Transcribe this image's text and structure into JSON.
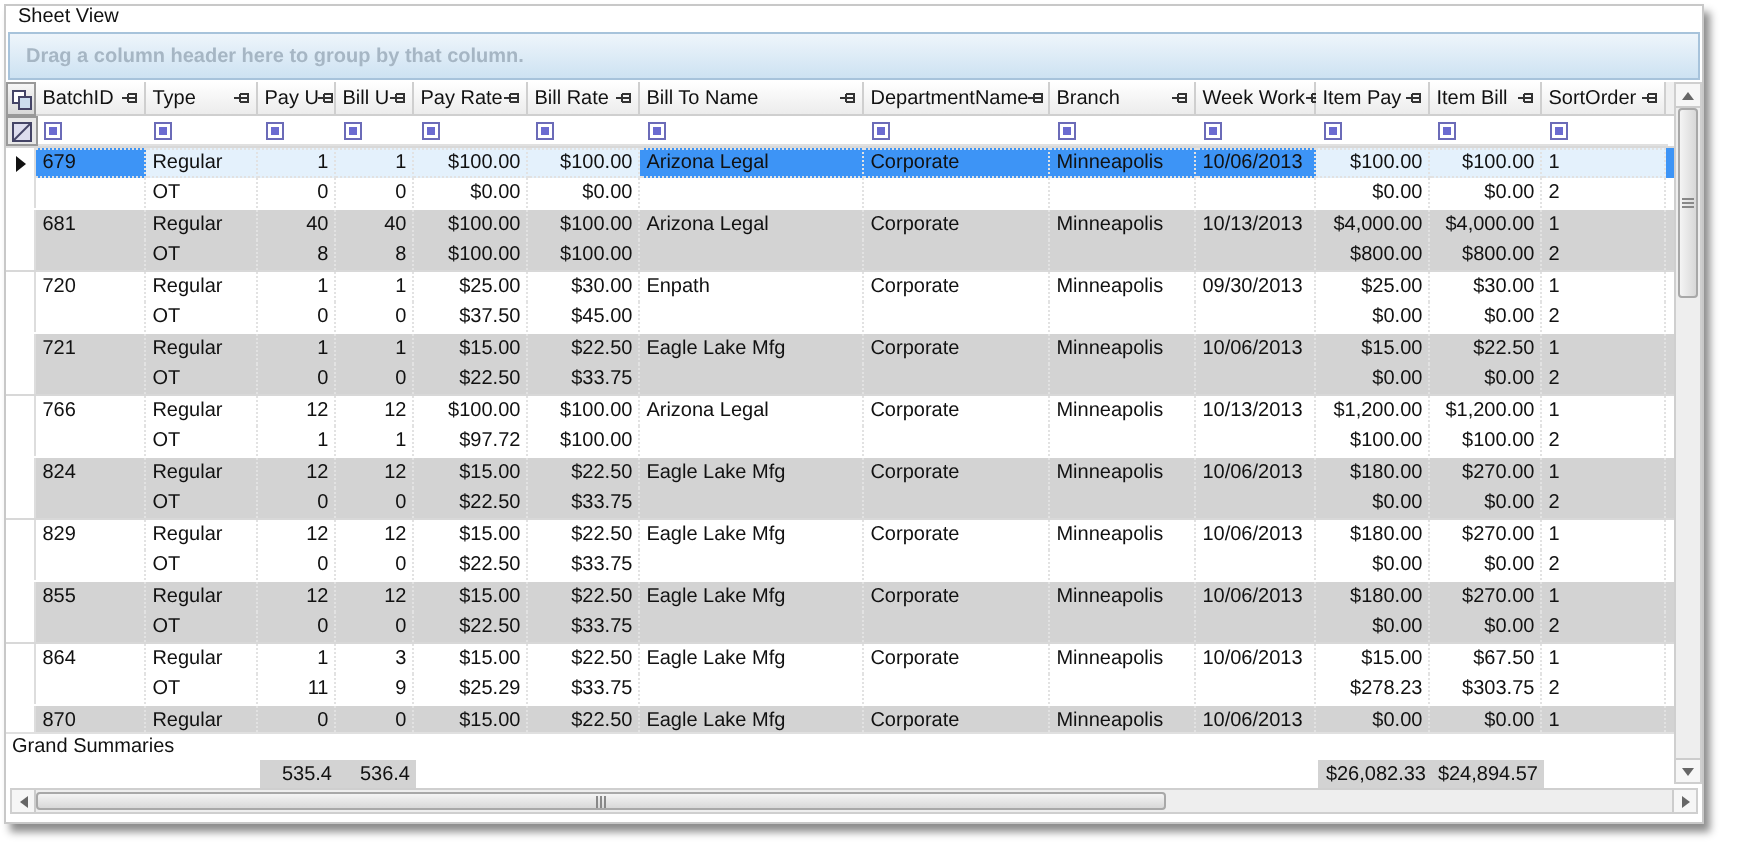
{
  "group_box": {
    "title": "Sheet View"
  },
  "group_by_area": {
    "text": "Drag a column header here to group by that column."
  },
  "columns": [
    "BatchID",
    "Type",
    "Pay U",
    "Bill U",
    "Pay Rate",
    "Bill Rate",
    "Bill To Name",
    "DepartmentName",
    "Branch",
    "Week Work",
    "Item Pay",
    "Item Bill",
    "SortOrder"
  ],
  "records": [
    {
      "selected": true,
      "rows": [
        {
          "batch_id": "679",
          "type": "Regular",
          "pay_u": "1",
          "bill_u": "1",
          "pay_rate": "$100.00",
          "bill_rate": "$100.00",
          "bill_to_name": "Arizona Legal",
          "department_name": "Corporate",
          "branch": "Minneapolis",
          "week_work": "10/06/2013",
          "item_pay": "$100.00",
          "item_bill": "$100.00",
          "sort_order": "1"
        },
        {
          "type": "OT",
          "pay_u": "0",
          "bill_u": "0",
          "pay_rate": "$0.00",
          "bill_rate": "$0.00",
          "item_pay": "$0.00",
          "item_bill": "$0.00",
          "sort_order": "2"
        }
      ]
    },
    {
      "selected": false,
      "rows": [
        {
          "batch_id": "681",
          "type": "Regular",
          "pay_u": "40",
          "bill_u": "40",
          "pay_rate": "$100.00",
          "bill_rate": "$100.00",
          "bill_to_name": "Arizona Legal",
          "department_name": "Corporate",
          "branch": "Minneapolis",
          "week_work": "10/13/2013",
          "item_pay": "$4,000.00",
          "item_bill": "$4,000.00",
          "sort_order": "1"
        },
        {
          "type": "OT",
          "pay_u": "8",
          "bill_u": "8",
          "pay_rate": "$100.00",
          "bill_rate": "$100.00",
          "item_pay": "$800.00",
          "item_bill": "$800.00",
          "sort_order": "2"
        }
      ]
    },
    {
      "selected": false,
      "rows": [
        {
          "batch_id": "720",
          "type": "Regular",
          "pay_u": "1",
          "bill_u": "1",
          "pay_rate": "$25.00",
          "bill_rate": "$30.00",
          "bill_to_name": "Enpath",
          "department_name": "Corporate",
          "branch": "Minneapolis",
          "week_work": "09/30/2013",
          "item_pay": "$25.00",
          "item_bill": "$30.00",
          "sort_order": "1"
        },
        {
          "type": "OT",
          "pay_u": "0",
          "bill_u": "0",
          "pay_rate": "$37.50",
          "bill_rate": "$45.00",
          "item_pay": "$0.00",
          "item_bill": "$0.00",
          "sort_order": "2"
        }
      ]
    },
    {
      "selected": false,
      "rows": [
        {
          "batch_id": "721",
          "type": "Regular",
          "pay_u": "1",
          "bill_u": "1",
          "pay_rate": "$15.00",
          "bill_rate": "$22.50",
          "bill_to_name": "Eagle Lake Mfg",
          "department_name": "Corporate",
          "branch": "Minneapolis",
          "week_work": "10/06/2013",
          "item_pay": "$15.00",
          "item_bill": "$22.50",
          "sort_order": "1"
        },
        {
          "type": "OT",
          "pay_u": "0",
          "bill_u": "0",
          "pay_rate": "$22.50",
          "bill_rate": "$33.75",
          "item_pay": "$0.00",
          "item_bill": "$0.00",
          "sort_order": "2"
        }
      ]
    },
    {
      "selected": false,
      "rows": [
        {
          "batch_id": "766",
          "type": "Regular",
          "pay_u": "12",
          "bill_u": "12",
          "pay_rate": "$100.00",
          "bill_rate": "$100.00",
          "bill_to_name": "Arizona Legal",
          "department_name": "Corporate",
          "branch": "Minneapolis",
          "week_work": "10/13/2013",
          "item_pay": "$1,200.00",
          "item_bill": "$1,200.00",
          "sort_order": "1"
        },
        {
          "type": "OT",
          "pay_u": "1",
          "bill_u": "1",
          "pay_rate": "$97.72",
          "bill_rate": "$100.00",
          "item_pay": "$100.00",
          "item_bill": "$100.00",
          "sort_order": "2"
        }
      ]
    },
    {
      "selected": false,
      "rows": [
        {
          "batch_id": "824",
          "type": "Regular",
          "pay_u": "12",
          "bill_u": "12",
          "pay_rate": "$15.00",
          "bill_rate": "$22.50",
          "bill_to_name": "Eagle Lake Mfg",
          "department_name": "Corporate",
          "branch": "Minneapolis",
          "week_work": "10/06/2013",
          "item_pay": "$180.00",
          "item_bill": "$270.00",
          "sort_order": "1"
        },
        {
          "type": "OT",
          "pay_u": "0",
          "bill_u": "0",
          "pay_rate": "$22.50",
          "bill_rate": "$33.75",
          "item_pay": "$0.00",
          "item_bill": "$0.00",
          "sort_order": "2"
        }
      ]
    },
    {
      "selected": false,
      "rows": [
        {
          "batch_id": "829",
          "type": "Regular",
          "pay_u": "12",
          "bill_u": "12",
          "pay_rate": "$15.00",
          "bill_rate": "$22.50",
          "bill_to_name": "Eagle Lake Mfg",
          "department_name": "Corporate",
          "branch": "Minneapolis",
          "week_work": "10/06/2013",
          "item_pay": "$180.00",
          "item_bill": "$270.00",
          "sort_order": "1"
        },
        {
          "type": "OT",
          "pay_u": "0",
          "bill_u": "0",
          "pay_rate": "$22.50",
          "bill_rate": "$33.75",
          "item_pay": "$0.00",
          "item_bill": "$0.00",
          "sort_order": "2"
        }
      ]
    },
    {
      "selected": false,
      "rows": [
        {
          "batch_id": "855",
          "type": "Regular",
          "pay_u": "12",
          "bill_u": "12",
          "pay_rate": "$15.00",
          "bill_rate": "$22.50",
          "bill_to_name": "Eagle Lake Mfg",
          "department_name": "Corporate",
          "branch": "Minneapolis",
          "week_work": "10/06/2013",
          "item_pay": "$180.00",
          "item_bill": "$270.00",
          "sort_order": "1"
        },
        {
          "type": "OT",
          "pay_u": "0",
          "bill_u": "0",
          "pay_rate": "$22.50",
          "bill_rate": "$33.75",
          "item_pay": "$0.00",
          "item_bill": "$0.00",
          "sort_order": "2"
        }
      ]
    },
    {
      "selected": false,
      "rows": [
        {
          "batch_id": "864",
          "type": "Regular",
          "pay_u": "1",
          "bill_u": "3",
          "pay_rate": "$15.00",
          "bill_rate": "$22.50",
          "bill_to_name": "Eagle Lake Mfg",
          "department_name": "Corporate",
          "branch": "Minneapolis",
          "week_work": "10/06/2013",
          "item_pay": "$15.00",
          "item_bill": "$67.50",
          "sort_order": "1"
        },
        {
          "type": "OT",
          "pay_u": "11",
          "bill_u": "9",
          "pay_rate": "$25.29",
          "bill_rate": "$33.75",
          "item_pay": "$278.23",
          "item_bill": "$303.75",
          "sort_order": "2"
        }
      ]
    },
    {
      "selected": false,
      "rows": [
        {
          "batch_id": "870",
          "type": "Regular",
          "pay_u": "0",
          "bill_u": "0",
          "pay_rate": "$15.00",
          "bill_rate": "$22.50",
          "bill_to_name": "Eagle Lake Mfg",
          "department_name": "Corporate",
          "branch": "Minneapolis",
          "week_work": "10/06/2013",
          "item_pay": "$0.00",
          "item_bill": "$0.00",
          "sort_order": "1"
        }
      ]
    }
  ],
  "grand_summaries": {
    "title": "Grand Summaries",
    "pay_u": "535.4",
    "bill_u": "536.4",
    "item_pay": "$26,082.33",
    "item_bill": "$24,894.57"
  }
}
